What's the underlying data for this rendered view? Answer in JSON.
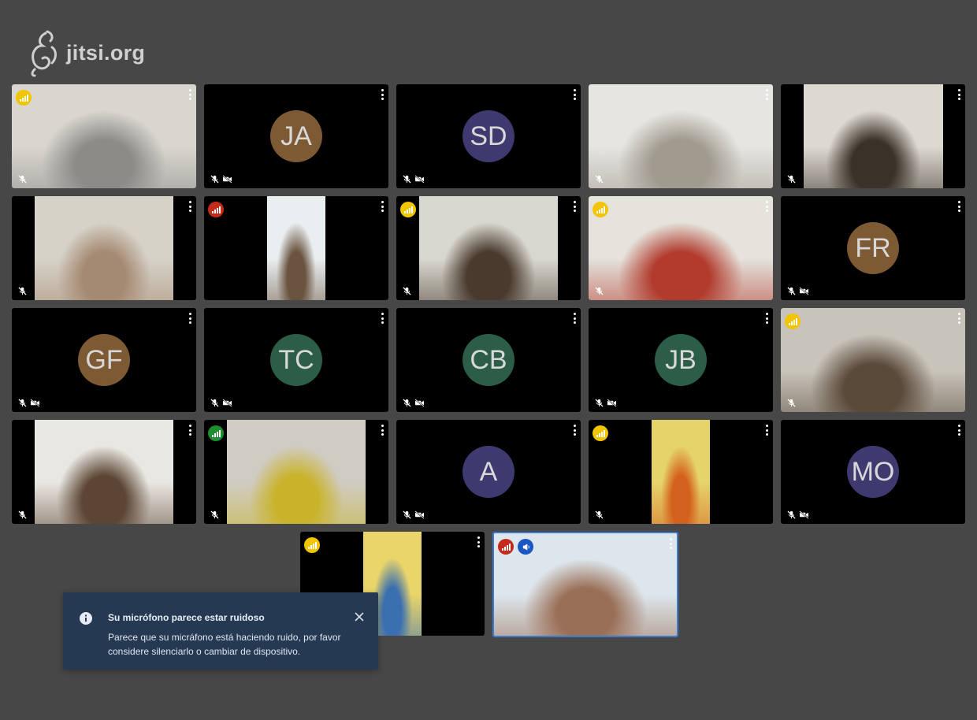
{
  "app": {
    "logo_text": "jitsi.org",
    "colors": {
      "background": "#474747",
      "tile": "#000000",
      "active_border": "#3b7bd0",
      "toast_bg": "#253952",
      "conn_good": "#1f8e2e",
      "conn_fair": "#f3c500",
      "conn_poor": "#c62a1a"
    }
  },
  "participants": [
    {
      "initials": "",
      "video": true,
      "conn": "fair",
      "muted": true,
      "video_muted": false
    },
    {
      "initials": "JA",
      "video": false,
      "conn": null,
      "muted": true,
      "video_muted": true,
      "avatar_color": "#7d5a34"
    },
    {
      "initials": "SD",
      "video": false,
      "conn": null,
      "muted": true,
      "video_muted": true,
      "avatar_color": "#3e3a70"
    },
    {
      "initials": "",
      "video": true,
      "conn": null,
      "muted": true,
      "video_muted": false
    },
    {
      "initials": "",
      "video": true,
      "conn": null,
      "muted": true,
      "video_muted": false
    },
    {
      "initials": "",
      "video": true,
      "conn": null,
      "muted": true,
      "video_muted": false
    },
    {
      "initials": "",
      "video": true,
      "conn": "poor",
      "muted": false,
      "video_muted": false
    },
    {
      "initials": "",
      "video": true,
      "conn": "fair",
      "muted": true,
      "video_muted": false
    },
    {
      "initials": "",
      "video": true,
      "conn": "fair",
      "muted": true,
      "video_muted": false
    },
    {
      "initials": "FR",
      "video": false,
      "conn": null,
      "muted": true,
      "video_muted": true,
      "avatar_color": "#7d5a34"
    },
    {
      "initials": "GF",
      "video": false,
      "conn": null,
      "muted": true,
      "video_muted": true,
      "avatar_color": "#7d5a34"
    },
    {
      "initials": "TC",
      "video": false,
      "conn": null,
      "muted": true,
      "video_muted": true,
      "avatar_color": "#2c5e47"
    },
    {
      "initials": "CB",
      "video": false,
      "conn": null,
      "muted": true,
      "video_muted": true,
      "avatar_color": "#2c5e47"
    },
    {
      "initials": "JB",
      "video": false,
      "conn": null,
      "muted": true,
      "video_muted": true,
      "avatar_color": "#2c5e47"
    },
    {
      "initials": "",
      "video": true,
      "conn": "fair",
      "muted": true,
      "video_muted": false
    },
    {
      "initials": "",
      "video": true,
      "conn": null,
      "muted": true,
      "video_muted": false
    },
    {
      "initials": "",
      "video": true,
      "conn": "good",
      "muted": true,
      "video_muted": false
    },
    {
      "initials": "A",
      "video": false,
      "conn": null,
      "muted": true,
      "video_muted": true,
      "avatar_color": "#3e3a70"
    },
    {
      "initials": "",
      "video": true,
      "conn": "fair",
      "muted": true,
      "video_muted": false
    },
    {
      "initials": "MO",
      "video": false,
      "conn": null,
      "muted": true,
      "video_muted": true,
      "avatar_color": "#3e3a70"
    },
    {
      "initials": "",
      "video": true,
      "conn": "fair",
      "muted": false,
      "video_muted": false
    },
    {
      "initials": "",
      "video": true,
      "conn": "poor",
      "muted": false,
      "video_muted": false,
      "dominant": true,
      "active": true
    }
  ],
  "notification": {
    "title": "Su micrófono parece estar ruidoso",
    "body": "Parece que su micráfono está haciendo ruido, por favor considere silenciarlo o cambiar de dispositivo.",
    "icon": "info-icon",
    "close_icon": "close-icon"
  }
}
